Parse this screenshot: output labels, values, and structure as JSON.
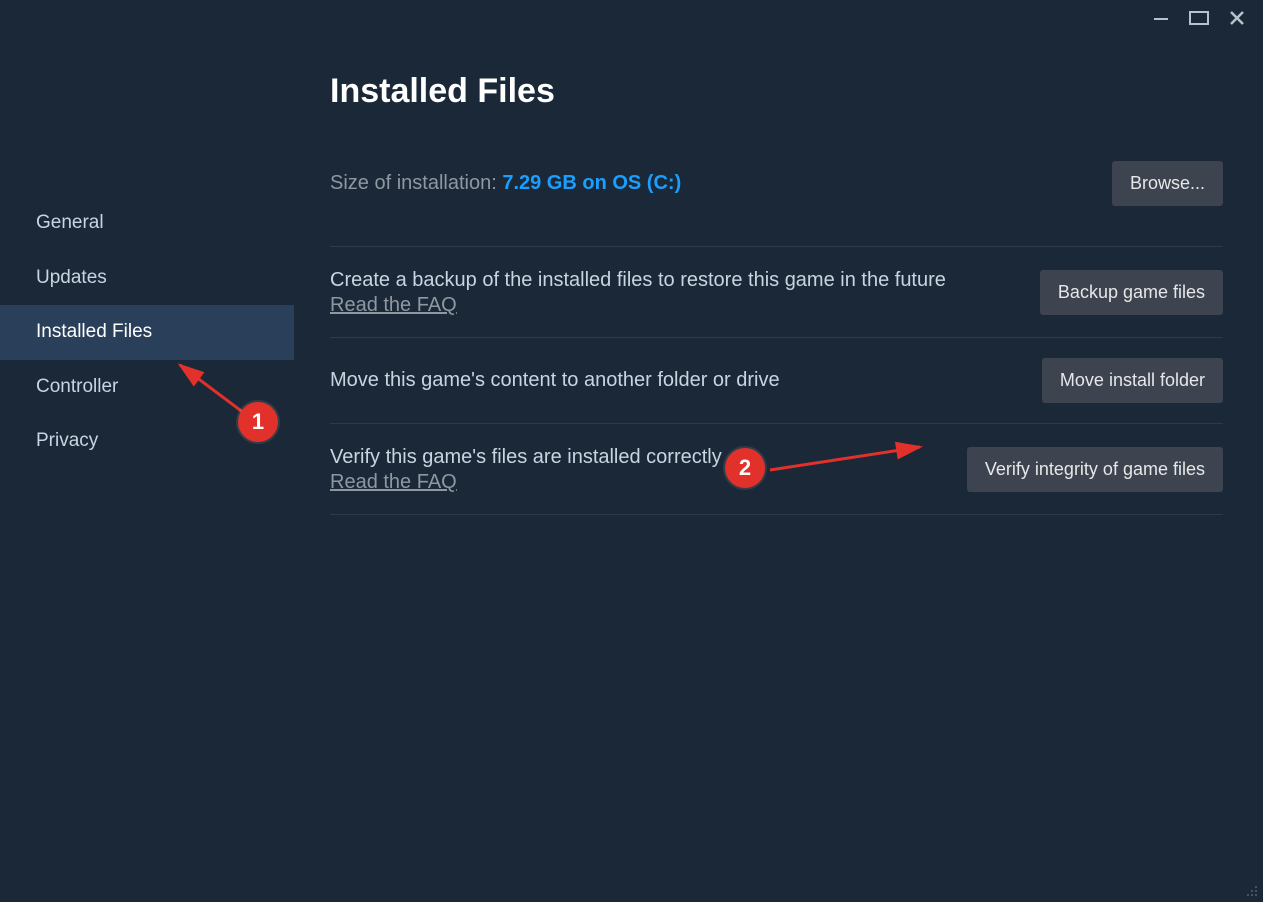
{
  "page": {
    "title": "Installed Files",
    "size_label": "Size of installation: ",
    "size_value": "7.29 GB on OS (C:)",
    "browse_label": "Browse..."
  },
  "sidebar": {
    "items": [
      {
        "label": "General"
      },
      {
        "label": "Updates"
      },
      {
        "label": "Installed Files"
      },
      {
        "label": "Controller"
      },
      {
        "label": "Privacy"
      }
    ]
  },
  "sections": {
    "backup": {
      "text": "Create a backup of the installed files to restore this game in the future",
      "faq": "Read the FAQ",
      "button": "Backup game files"
    },
    "move": {
      "text": "Move this game's content to another folder or drive",
      "button": "Move install folder"
    },
    "verify": {
      "text": "Verify this game's files are installed correctly",
      "faq": "Read the FAQ",
      "button": "Verify integrity of game files"
    }
  },
  "annotations": {
    "badge1": "1",
    "badge2": "2"
  }
}
